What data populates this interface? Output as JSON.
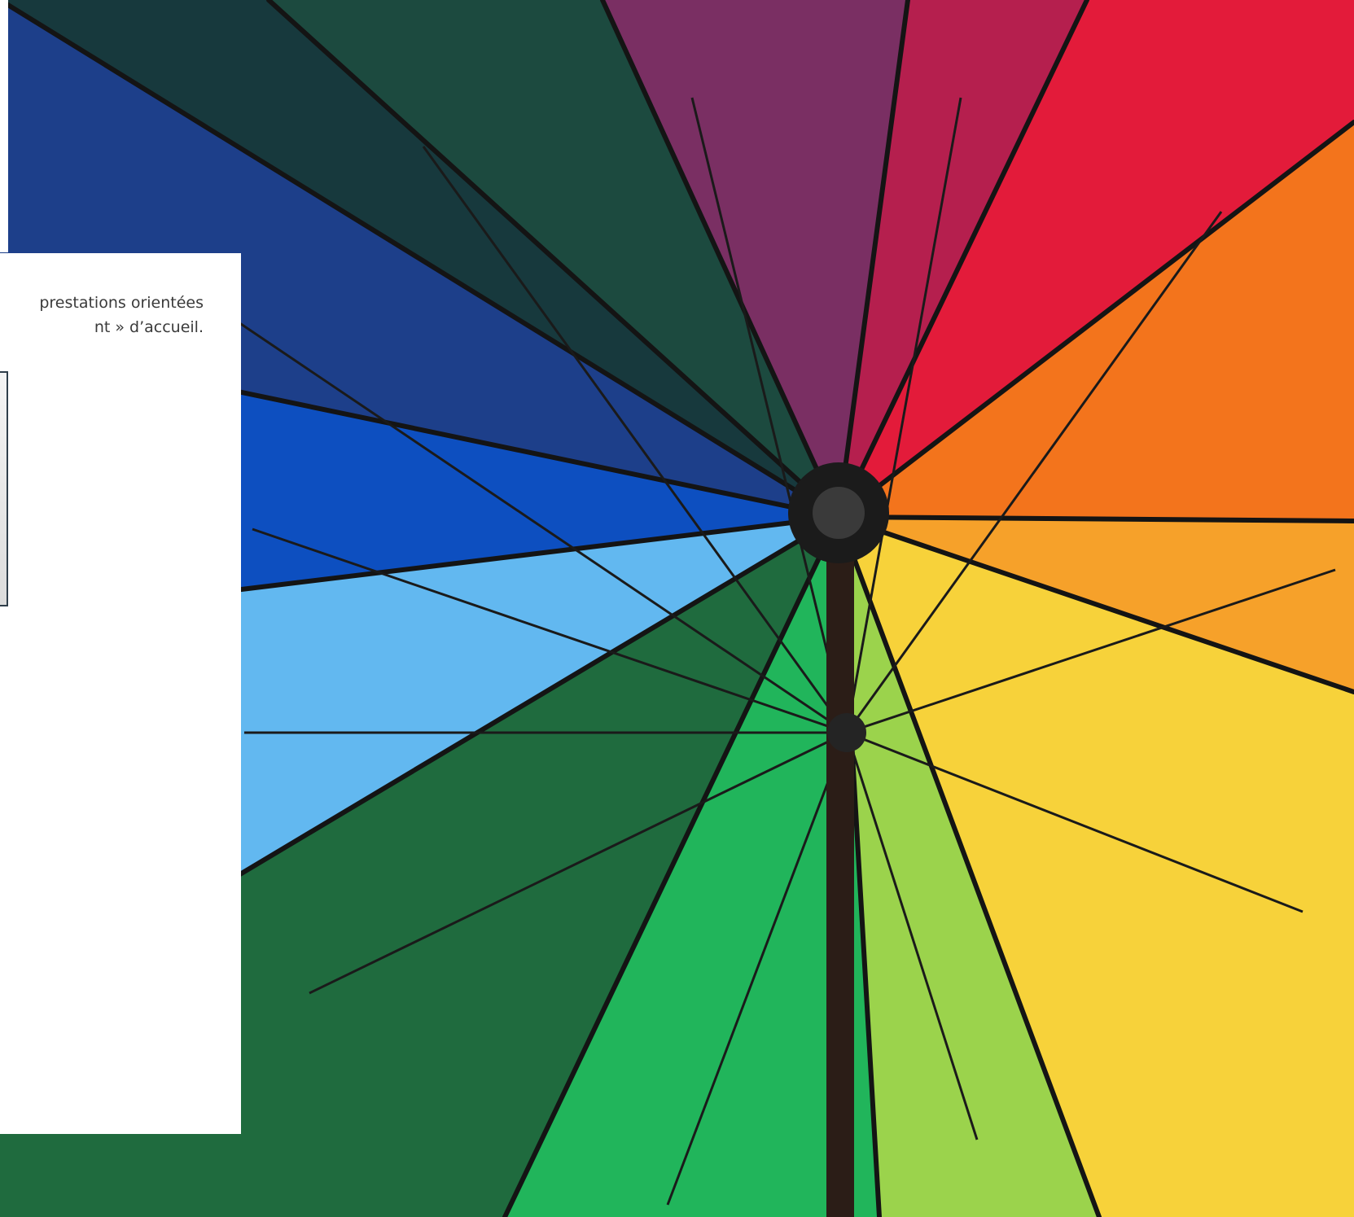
{
  "card": {
    "line_1": "prestations orientées",
    "line_2": "nt » d’accueil."
  },
  "hero": {
    "image": "rainbow-umbrella-photo",
    "colors": [
      "#7a2f63",
      "#e31b3a",
      "#f3741c",
      "#f7d23a",
      "#21b55b",
      "#1f6b3e",
      "#62b8f0",
      "#0d4fc0",
      "#17393d"
    ]
  }
}
